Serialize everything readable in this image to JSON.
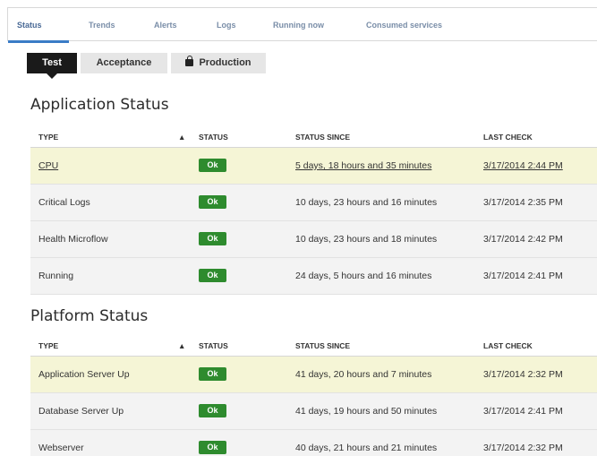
{
  "top_tabs": [
    {
      "label": "Status",
      "active": true
    },
    {
      "label": "Trends"
    },
    {
      "label": "Alerts"
    },
    {
      "label": "Logs"
    },
    {
      "label": "Running now"
    },
    {
      "label": "Consumed services"
    }
  ],
  "environments": [
    {
      "label": "Test",
      "active": true
    },
    {
      "label": "Acceptance"
    },
    {
      "label": "Production",
      "icon": "lock-icon"
    }
  ],
  "columns": {
    "type": "TYPE",
    "sort_arrow": "▲",
    "status": "STATUS",
    "status_since": "STATUS SINCE",
    "last_check": "LAST CHECK"
  },
  "application_status": {
    "title": "Application Status",
    "rows": [
      {
        "type": "CPU",
        "status": "Ok",
        "since": "5 days, 18 hours and 35 minutes",
        "last_check": "3/17/2014 2:44 PM"
      },
      {
        "type": "Critical Logs",
        "status": "Ok",
        "since": "10 days, 23 hours and 16 minutes",
        "last_check": "3/17/2014 2:35 PM"
      },
      {
        "type": "Health Microflow",
        "status": "Ok",
        "since": "10 days, 23 hours and 18 minutes",
        "last_check": "3/17/2014 2:42 PM"
      },
      {
        "type": "Running",
        "status": "Ok",
        "since": "24 days, 5 hours and 16 minutes",
        "last_check": "3/17/2014 2:41 PM"
      }
    ]
  },
  "platform_status": {
    "title": "Platform Status",
    "rows": [
      {
        "type": "Application Server Up",
        "status": "Ok",
        "since": "41 days, 20 hours and 7 minutes",
        "last_check": "3/17/2014 2:32 PM"
      },
      {
        "type": "Database Server Up",
        "status": "Ok",
        "since": "41 days, 19 hours and 50 minutes",
        "last_check": "3/17/2014 2:41 PM"
      },
      {
        "type": "Webserver",
        "status": "Ok",
        "since": "40 days, 21 hours and 21 minutes",
        "last_check": "3/17/2014 2:32 PM"
      }
    ]
  },
  "colors": {
    "ok_badge": "#2e8b2e",
    "highlight_row": "#f5f5d6",
    "active_tab_underline": "#3a7cc6"
  }
}
